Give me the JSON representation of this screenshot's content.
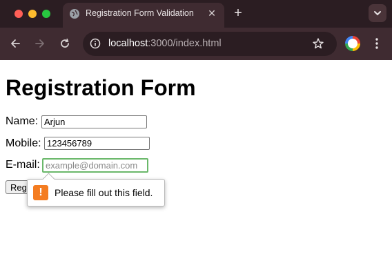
{
  "browser": {
    "tab": {
      "title": "Registration Form Validation",
      "favicon": "globe-icon"
    },
    "address": {
      "host": "localhost",
      "rest": ":3000/index.html"
    }
  },
  "form": {
    "heading": "Registration Form",
    "name": {
      "label": "Name:",
      "value": "Arjun"
    },
    "mobile": {
      "label": "Mobile:",
      "value": "123456789"
    },
    "email": {
      "label": "E-mail:",
      "value": "",
      "placeholder": "example@domain.com"
    },
    "submit_label": "Register"
  },
  "validation": {
    "message": "Please fill out this field.",
    "icon": "warning-icon"
  },
  "colors": {
    "focus_border": "#6ab86a",
    "warning": "#f47c20"
  }
}
